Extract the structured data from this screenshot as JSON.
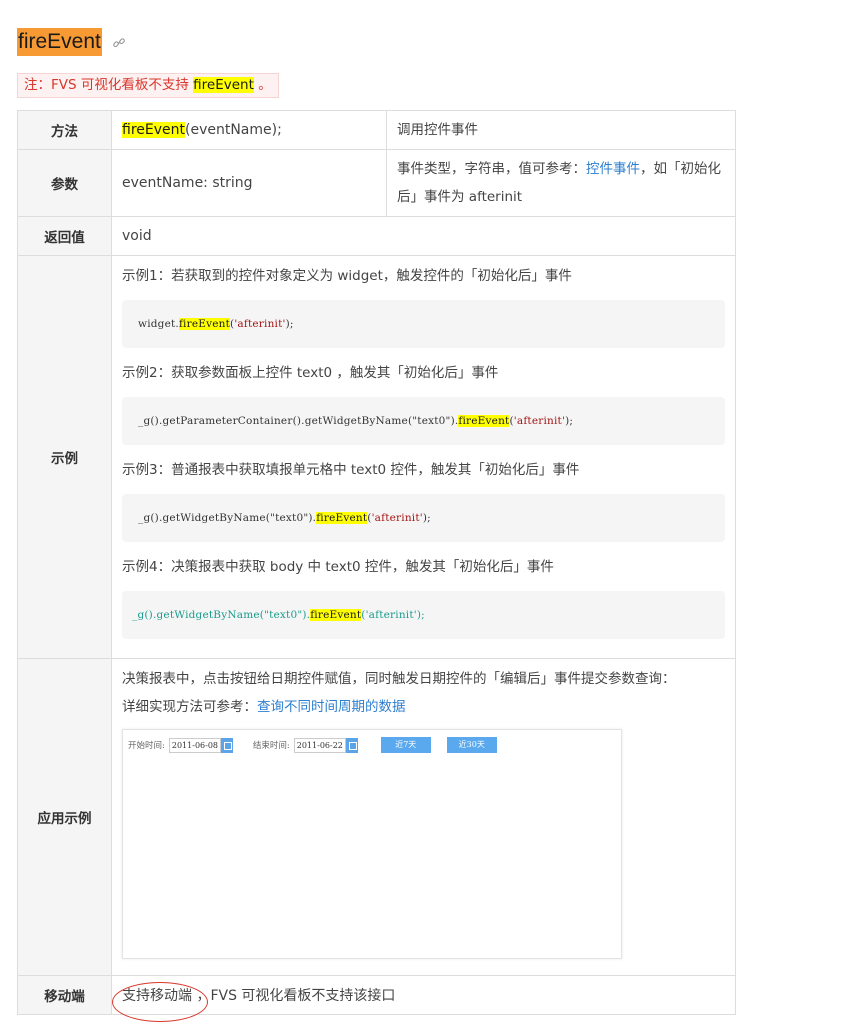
{
  "title": "fireEvent",
  "note": {
    "prefix": "注：FVS 可视化看板不支持 ",
    "highlight": "fireEvent",
    "suffix": " 。"
  },
  "table": {
    "method": {
      "label": "方法",
      "name": "fireEvent",
      "signature_rest": "(eventName);",
      "description": "调用控件事件"
    },
    "params": {
      "label": "参数",
      "value": "eventName: string",
      "desc_prefix": "事件类型，字符串，值可参考：",
      "desc_link": "控件事件",
      "desc_suffix": "，如「初始化后」事件为 afterinit"
    },
    "returns": {
      "label": "返回值",
      "value": "void"
    },
    "examples": {
      "label": "示例",
      "items": [
        {
          "text": "示例1：若获取到的控件对象定义为 widget，触发控件的「初始化后」事件",
          "code_pre": "widget.",
          "code_fn": "fireEvent",
          "code_paren": "(",
          "code_str": "'afterinit'",
          "code_end": ");"
        },
        {
          "text": "示例2：获取参数面板上控件 text0 ，触发其「初始化后」事件",
          "code_pre": "_g().getParameterContainer().getWidgetByName(\"text0\").",
          "code_fn": "fireEvent",
          "code_paren": "(",
          "code_str": "'afterinit'",
          "code_end": ");"
        },
        {
          "text": "示例3：普通报表中获取填报单元格中 text0 控件，触发其「初始化后」事件",
          "code_pre": "_g().getWidgetByName(\"text0\").",
          "code_fn": "fireEvent",
          "code_paren": "(",
          "code_str": "'afterinit'",
          "code_end": ");"
        },
        {
          "text": "示例4：决策报表中获取 body 中 text0 控件，触发其「初始化后」事件",
          "code_pre": "_g().getWidgetByName(\"text0\").",
          "code_fn": "fireEvent",
          "code_paren": "(",
          "code_str": "'afterinit'",
          "code_end": ");"
        }
      ]
    },
    "application": {
      "label": "应用示例",
      "line1": "决策报表中，点击按钮给日期控件赋值，同时触发日期控件的「编辑后」事件提交参数查询：",
      "line2_prefix": "详细实现方法可参考：",
      "line2_link": "查询不同时间周期的数据",
      "preview": {
        "start_label": "开始时间:",
        "start_date": "2011-06-08",
        "end_label": "结束时间:",
        "end_date": "2011-06-22",
        "button1": "近7天",
        "button2": "近30天"
      }
    },
    "mobile": {
      "label": "移动端",
      "supported": "支持移动端",
      "rest": "，FVS 可视化看板不支持该接口"
    }
  },
  "colors": {
    "title_bg": "#f79a34",
    "highlight": "#ffff00",
    "note_text": "#d9382c",
    "link": "#2e7fd0",
    "teal_code": "#1a9c8c"
  }
}
